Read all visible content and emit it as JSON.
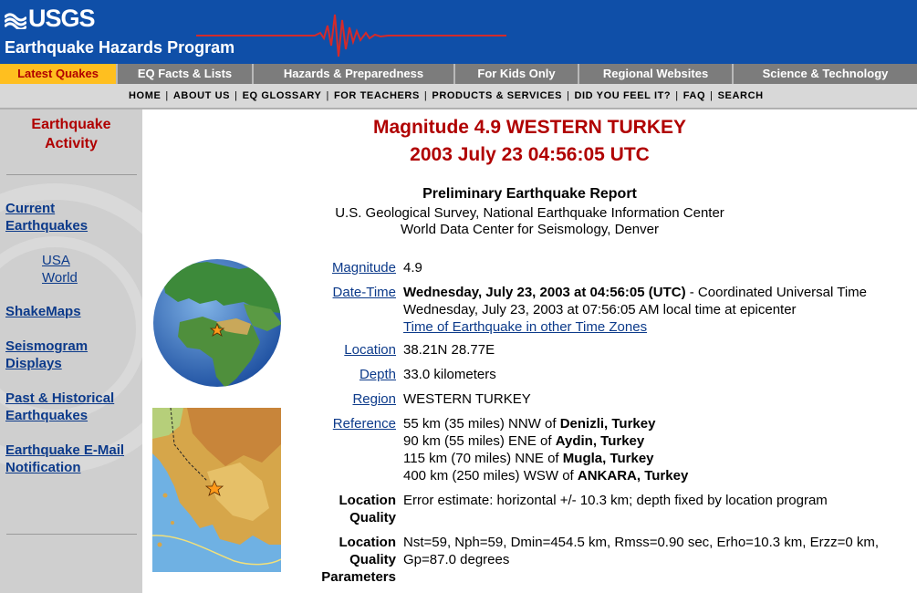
{
  "header": {
    "logo_text": "USGS",
    "program_title": "Earthquake Hazards Program",
    "colors": {
      "banner": "#0f4fa8",
      "seismogram": "#d42a2a"
    }
  },
  "tabs": [
    {
      "label": "Latest Quakes",
      "active": true
    },
    {
      "label": "EQ Facts & Lists",
      "active": false
    },
    {
      "label": "Hazards & Preparedness",
      "active": false
    },
    {
      "label": "For Kids Only",
      "active": false
    },
    {
      "label": "Regional Websites",
      "active": false
    },
    {
      "label": "Science & Technology",
      "active": false
    }
  ],
  "subnav": [
    "HOME",
    "ABOUT US",
    "EQ GLOSSARY",
    "FOR TEACHERS",
    "PRODUCTS & SERVICES",
    "DID YOU FEEL IT?",
    "FAQ",
    "SEARCH"
  ],
  "sidebar": {
    "title_line1": "Earthquake",
    "title_line2": "Activity",
    "current": {
      "line1": "Current",
      "line2": "Earthquakes"
    },
    "usa": "USA",
    "world": "World",
    "shakemaps": "ShakeMaps",
    "seismogram": {
      "line1": "Seismogram",
      "line2": "Displays"
    },
    "historical": {
      "line1": "Past & Historical",
      "line2": "Earthquakes"
    },
    "email": {
      "line1": "Earthquake E-Mail",
      "line2": "Notification"
    }
  },
  "main": {
    "title_line1": "Magnitude 4.9 WESTERN TURKEY",
    "title_line2": "2003 July 23 04:56:05 UTC",
    "report_title": "Preliminary Earthquake Report",
    "report_line1": "U.S. Geological Survey, National Earthquake Information Center",
    "report_line2": "World Data Center for Seismology, Denver"
  },
  "details": {
    "magnitude": {
      "label": "Magnitude",
      "value": "4.9"
    },
    "datetime": {
      "label": "Date-Time",
      "utc_bold": "Wednesday, July 23, 2003 at 04:56:05 (UTC)",
      "utc_suffix": " - Coordinated Universal Time",
      "local": "Wednesday, July 23, 2003 at 07:56:05 AM local time at epicenter",
      "timezone_link": "Time of Earthquake in other Time Zones"
    },
    "location": {
      "label": "Location",
      "value": "38.21N 28.77E"
    },
    "depth": {
      "label": "Depth",
      "value": "33.0 kilometers"
    },
    "region": {
      "label": "Region",
      "value": "WESTERN TURKEY"
    },
    "reference": {
      "label": "Reference",
      "lines": [
        {
          "prefix": "55 km (35 miles) NNW of ",
          "place": "Denizli, Turkey"
        },
        {
          "prefix": "90 km (55 miles) ENE of ",
          "place": "Aydin, Turkey"
        },
        {
          "prefix": "115 km (70 miles) NNE of ",
          "place": "Mugla, Turkey"
        },
        {
          "prefix": "400 km (250 miles) WSW of ",
          "place": "ANKARA, Turkey"
        }
      ]
    },
    "quality": {
      "label_line1": "Location",
      "label_line2": "Quality",
      "value": "Error estimate: horizontal +/- 10.3 km; depth fixed by location program"
    },
    "quality_params": {
      "label_line1": "Location",
      "label_line2": "Quality",
      "label_line3": "Parameters",
      "value_line1": "Nst=59, Nph=59, Dmin=454.5 km, Rmss=0.90 sec, Erho=10.3 km, Erzz=0 km,",
      "value_line2": "Gp=87.0 degrees"
    }
  },
  "icons": [
    "usgs-logo-icon",
    "seismogram-icon",
    "globe-map",
    "regional-map",
    "epicenter-star-icon"
  ]
}
